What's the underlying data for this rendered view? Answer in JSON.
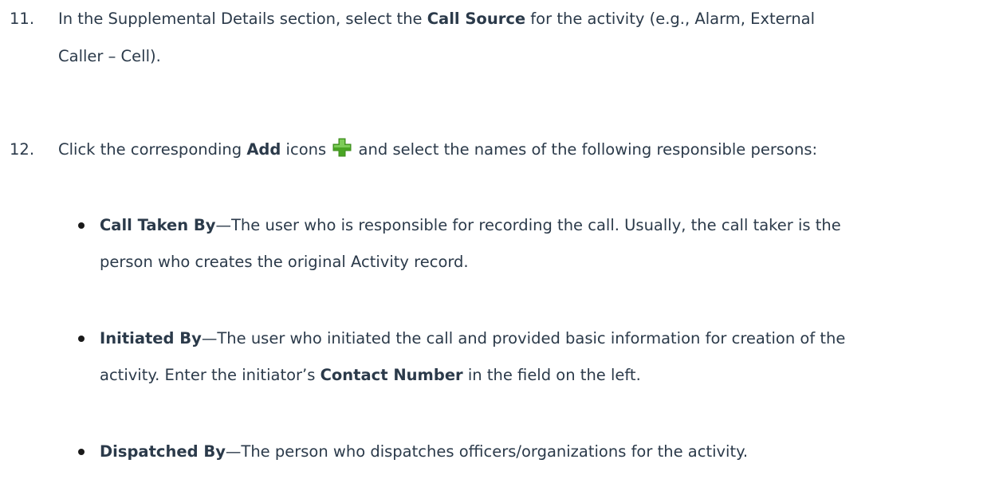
{
  "steps": [
    {
      "number": "11.",
      "line1_pre": "In the Supplemental Details section, select the ",
      "line1_bold": "Call Source",
      "line1_post": " for the activity (e.g., Alarm, External",
      "line2": "Caller – Cell)."
    },
    {
      "number": "12.",
      "pre": "Click the corresponding ",
      "bold": "Add",
      "mid": " icons",
      "post": " and select the names of the following responsible persons:",
      "icon": "add-plus-icon",
      "icon_color": "#5cb531"
    }
  ],
  "bullets": [
    {
      "term": "Call Taken By",
      "line1": "—The user who is responsible for recording the call. Usually, the call taker is the",
      "line2": "person who creates the original Activity record."
    },
    {
      "term": "Initiated By",
      "line1": "—The user who initiated the call and provided basic information for creation of the",
      "line2_pre": "activity. Enter the initiator’s ",
      "line2_bold": "Contact Number",
      "line2_post": " in the field on the left."
    },
    {
      "term": "Dispatched By",
      "line1": "—The person who dispatches officers/organizations for the activity."
    }
  ]
}
